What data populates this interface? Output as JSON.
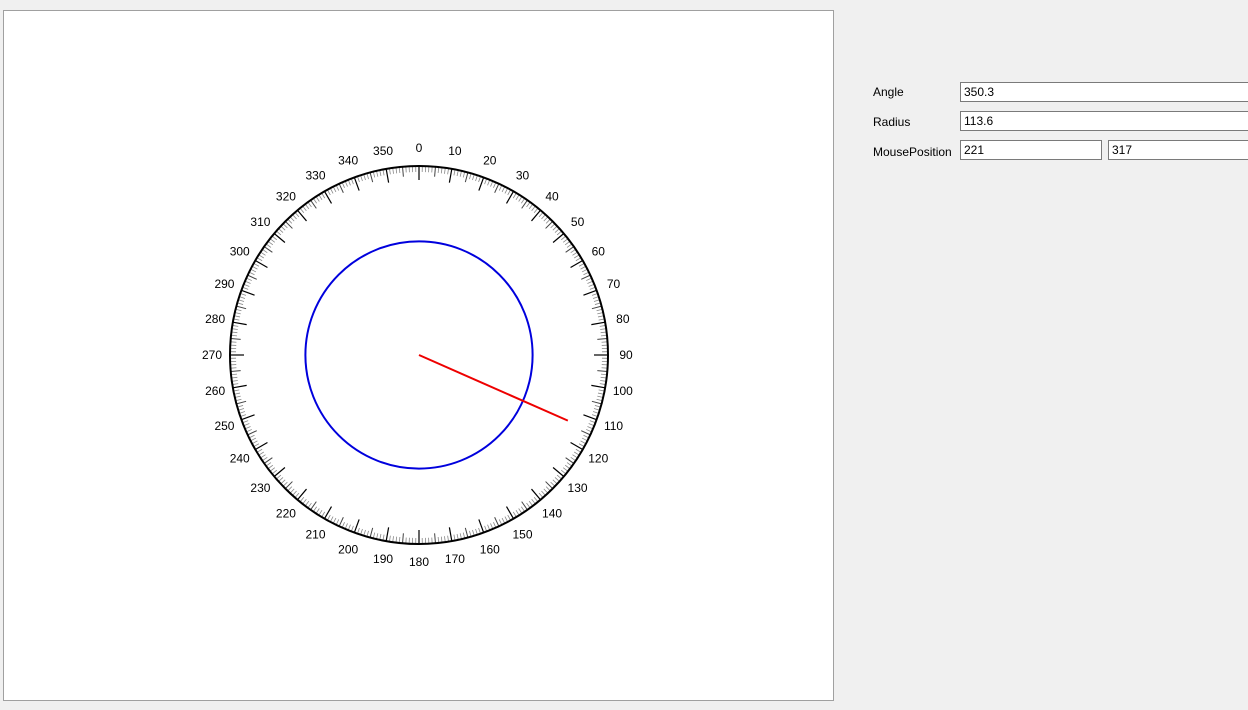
{
  "properties": {
    "angle": {
      "label": "Angle",
      "value": "350.3"
    },
    "radius": {
      "label": "Radius",
      "value": "113.6"
    },
    "mouse_position": {
      "label": "MousePosition",
      "x": "221",
      "y": "317"
    }
  },
  "dial": {
    "tick_labels": [
      "0",
      "10",
      "20",
      "30",
      "40",
      "50",
      "60",
      "70",
      "80",
      "90",
      "100",
      "110",
      "120",
      "130",
      "140",
      "150",
      "160",
      "170",
      "180",
      "190",
      "200",
      "210",
      "220",
      "230",
      "240",
      "250",
      "260",
      "270",
      "280",
      "290",
      "300",
      "310",
      "320",
      "330",
      "340",
      "350"
    ],
    "circle_color": "#0000dd",
    "pointer_color": "#ee0000",
    "scale_color": "#000000"
  }
}
